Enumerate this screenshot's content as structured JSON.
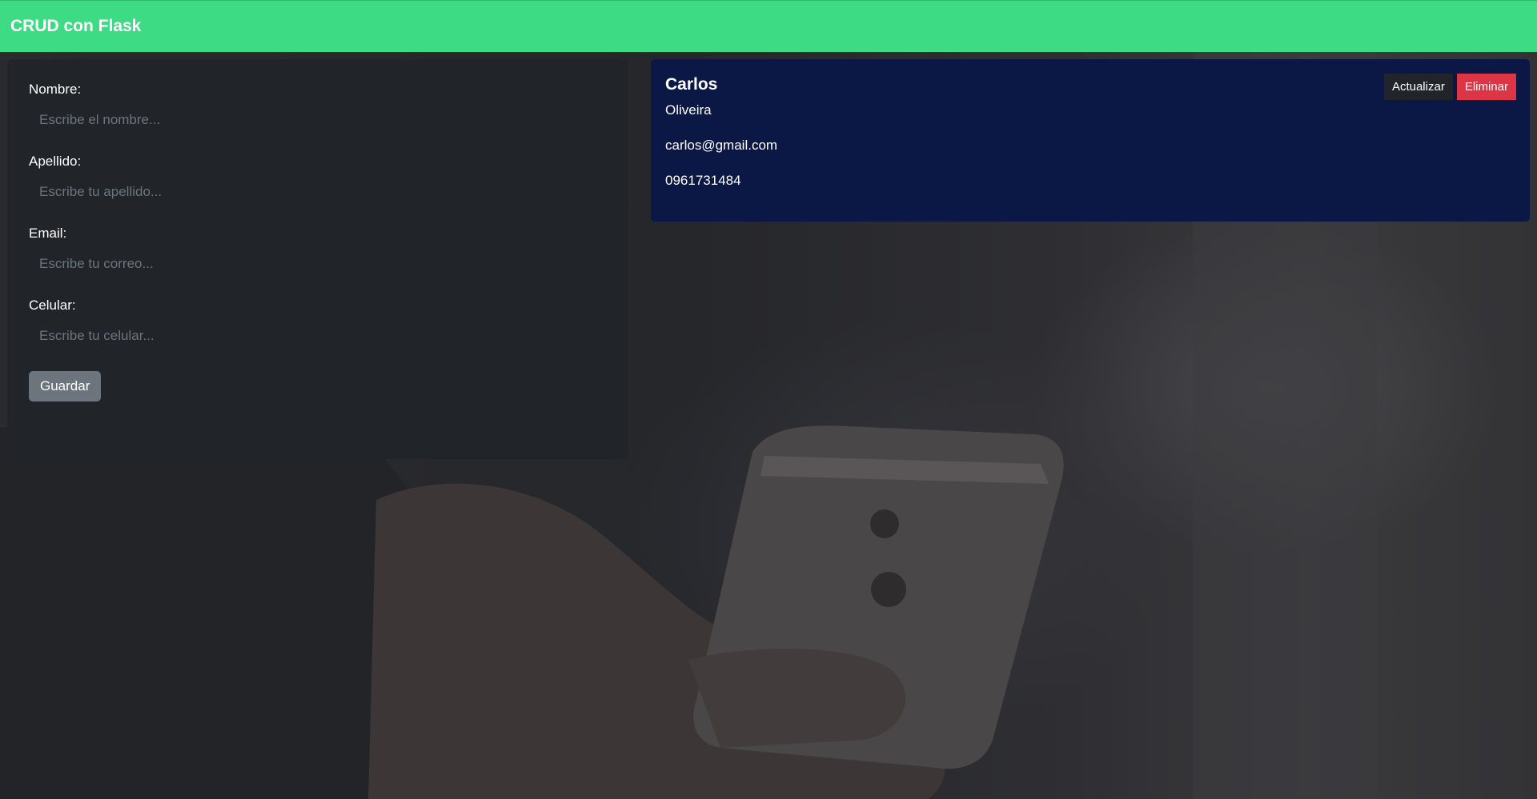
{
  "navbar": {
    "brand": "CRUD con Flask"
  },
  "form": {
    "fields": [
      {
        "label": "Nombre:",
        "placeholder": "Escribe el nombre..."
      },
      {
        "label": "Apellido:",
        "placeholder": "Escribe tu apellido..."
      },
      {
        "label": "Email:",
        "placeholder": "Escribe tu correo..."
      },
      {
        "label": "Celular:",
        "placeholder": "Escribe tu celular..."
      }
    ],
    "save_label": "Guardar"
  },
  "contacts": [
    {
      "name": "Carlos",
      "lastname": "Oliveira",
      "email": "carlos@gmail.com",
      "phone": "0961731484",
      "update_label": "Actualizar",
      "delete_label": "Eliminar"
    }
  ],
  "colors": {
    "navbar": "#3ddc84",
    "form_card": "#212428",
    "contact_card": "#0b1845",
    "save_button": "#6c757d",
    "update_button": "#212529",
    "delete_button": "#dc3545"
  }
}
